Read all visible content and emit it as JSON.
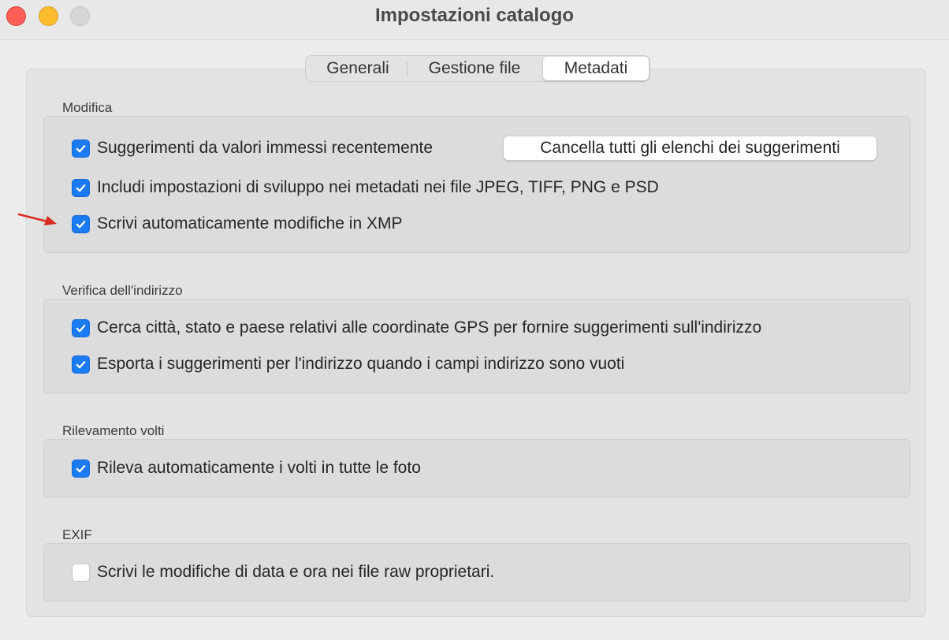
{
  "window": {
    "title": "Impostazioni catalogo"
  },
  "tabs": [
    {
      "label": "Generali",
      "active": false
    },
    {
      "label": "Gestione file",
      "active": false
    },
    {
      "label": "Metadati",
      "active": true
    }
  ],
  "sections": {
    "modifica": {
      "label": "Modifica",
      "items": [
        {
          "label": "Suggerimenti da valori immessi recentemente",
          "checked": true
        },
        {
          "label": "Includi impostazioni di sviluppo nei metadati nei file JPEG, TIFF, PNG e PSD",
          "checked": true
        },
        {
          "label": "Scrivi automaticamente modifiche in XMP",
          "checked": true
        }
      ],
      "clear_button": "Cancella tutti gli elenchi dei suggerimenti"
    },
    "indirizzo": {
      "label": "Verifica dell'indirizzo",
      "items": [
        {
          "label": "Cerca città, stato e paese relativi alle coordinate GPS per fornire suggerimenti sull'indirizzo",
          "checked": true
        },
        {
          "label": "Esporta i suggerimenti per l'indirizzo quando i campi indirizzo sono vuoti",
          "checked": true
        }
      ]
    },
    "volti": {
      "label": "Rilevamento volti",
      "items": [
        {
          "label": "Rileva automaticamente i volti in tutte le foto",
          "checked": true
        }
      ]
    },
    "exif": {
      "label": "EXIF",
      "items": [
        {
          "label": "Scrivi le modifiche di data e ora nei file raw proprietari.",
          "checked": false
        }
      ]
    }
  },
  "colors": {
    "checkbox_on": "#1b7bf2",
    "annotation_arrow": "#d92b1f"
  }
}
